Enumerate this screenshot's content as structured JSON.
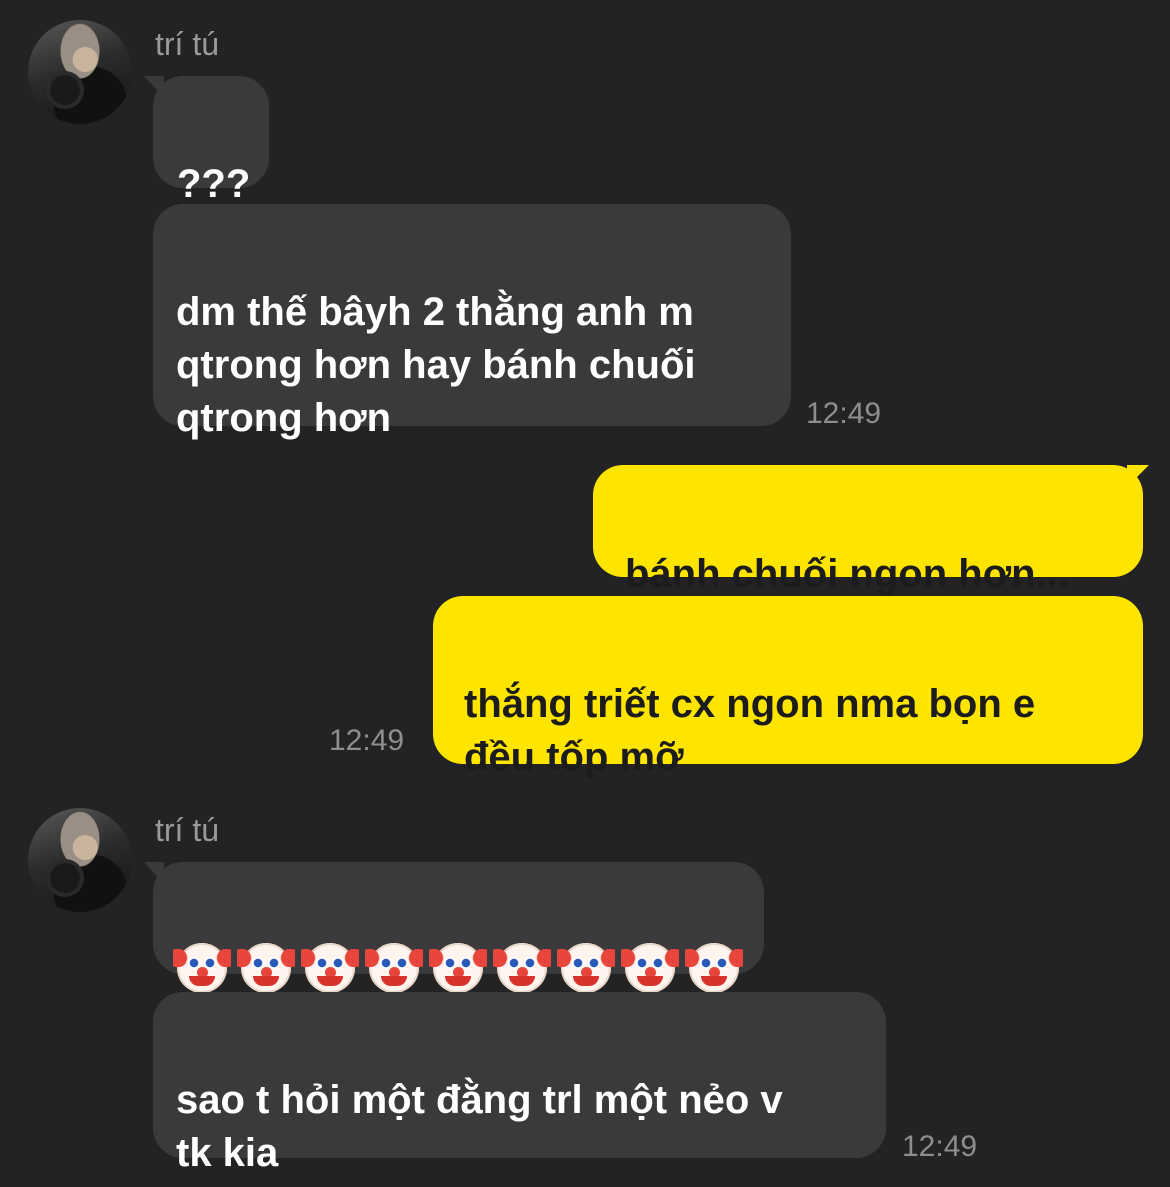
{
  "messages": [
    {
      "sender": "trí tú",
      "type": "incoming",
      "text": "???"
    },
    {
      "type": "incoming",
      "text": "dm thế bâyh 2 thằng anh m\nqtrong hơn hay bánh chuối\nqtrong hơn",
      "time": "12:49"
    },
    {
      "type": "outgoing",
      "text": "bánh chuối ngon hơn..."
    },
    {
      "type": "outgoing",
      "text": "thắng triết cx ngon nma bọn e\nđều tốp mỡ",
      "time": "12:49"
    },
    {
      "sender": "trí tú",
      "type": "incoming",
      "emoji": "clown-face",
      "emoji_count": 9
    },
    {
      "type": "incoming",
      "text": "sao t hỏi một đằng trl một nẻo v\ntk kia",
      "time": "12:49"
    }
  ],
  "colors": {
    "background": "#232325",
    "incoming_bubble": "#3a3a3c",
    "outgoing_bubble": "#fee500"
  },
  "icons": {
    "avatar": "profile-photo",
    "emoji": "clown-face"
  }
}
